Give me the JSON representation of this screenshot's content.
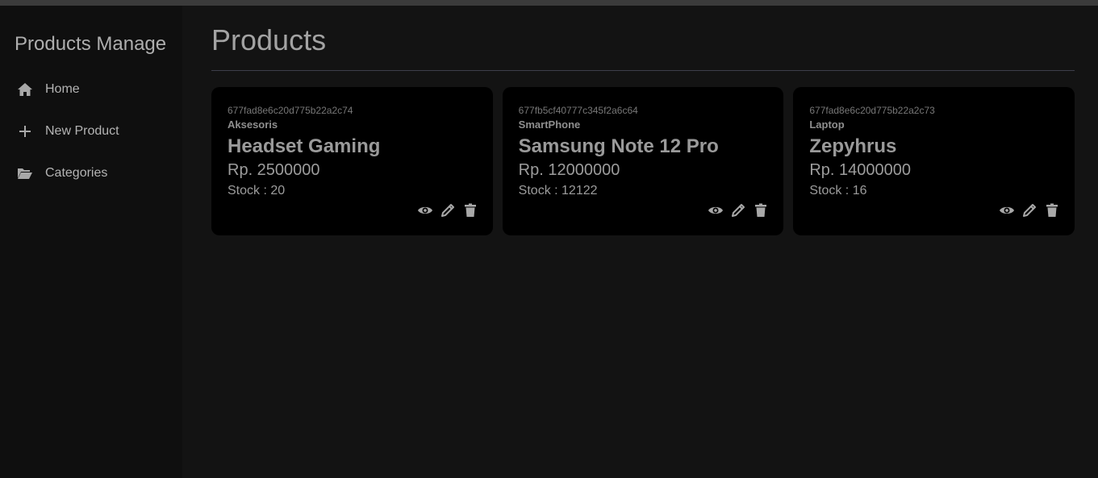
{
  "colors": {
    "background": "#131313",
    "sidebar": "#0f0f0f",
    "card": "#000000",
    "text_muted": "#9c9c9c",
    "divider": "#3d3f4b"
  },
  "sidebar": {
    "brand": "Products Manage",
    "items": [
      {
        "label": "Home",
        "icon": "home-icon"
      },
      {
        "label": "New Product",
        "icon": "plus-icon"
      },
      {
        "label": "Categories",
        "icon": "folder-open-icon"
      }
    ]
  },
  "main": {
    "title": "Products",
    "products": [
      {
        "id": "677fad8e6c20d775b22a2c74",
        "category": "Aksesoris",
        "name": "Headset Gaming",
        "price": "Rp. 2500000",
        "stock_label": "Stock : ",
        "stock": "20"
      },
      {
        "id": "677fb5cf40777c345f2a6c64",
        "category": "SmartPhone",
        "name": "Samsung Note 12 Pro",
        "price": "Rp. 12000000",
        "stock_label": "Stock : ",
        "stock": "12122"
      },
      {
        "id": "677fad8e6c20d775b22a2c73",
        "category": "Laptop",
        "name": "Zepyhrus",
        "price": "Rp. 14000000",
        "stock_label": "Stock : ",
        "stock": "16"
      }
    ],
    "action_icons": [
      "eye-icon",
      "pencil-icon",
      "trash-icon"
    ]
  }
}
